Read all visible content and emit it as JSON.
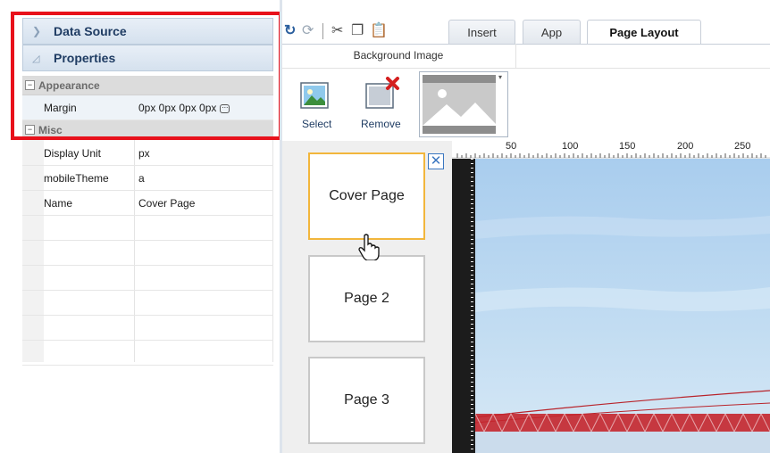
{
  "left_panel": {
    "data_source_label": "Data Source",
    "properties_label": "Properties",
    "categories": {
      "appearance": "Appearance",
      "misc": "Misc"
    },
    "rows": {
      "margin": {
        "name": "Margin",
        "value": "0px 0px 0px 0px"
      },
      "display_unit": {
        "name": "Display Unit",
        "value": "px"
      },
      "mobile_theme": {
        "name": "mobileTheme",
        "value": "a"
      },
      "page_name": {
        "name": "Name",
        "value": "Cover Page"
      }
    },
    "highlight_color": "#e8111b"
  },
  "ribbon": {
    "tabs": [
      "Insert",
      "App",
      "Page Layout"
    ],
    "active_tab": "Page Layout",
    "group_label": "Background Image",
    "select_label": "Select",
    "remove_label": "Remove",
    "qat_icons": [
      "redo-icon",
      "refresh-icon",
      "cut-icon",
      "copy-icon",
      "paste-icon"
    ]
  },
  "pages": [
    {
      "label": "Cover Page",
      "selected": true
    },
    {
      "label": "Page 2",
      "selected": false
    },
    {
      "label": "Page 3",
      "selected": false
    }
  ],
  "ruler": {
    "labels": [
      "50",
      "100",
      "150",
      "200",
      "250"
    ]
  },
  "colors": {
    "accent": "#1f3c63",
    "selected_page_border": "#f2b63c",
    "bridge": "#c4252c",
    "sky": "#b9d7f0"
  }
}
